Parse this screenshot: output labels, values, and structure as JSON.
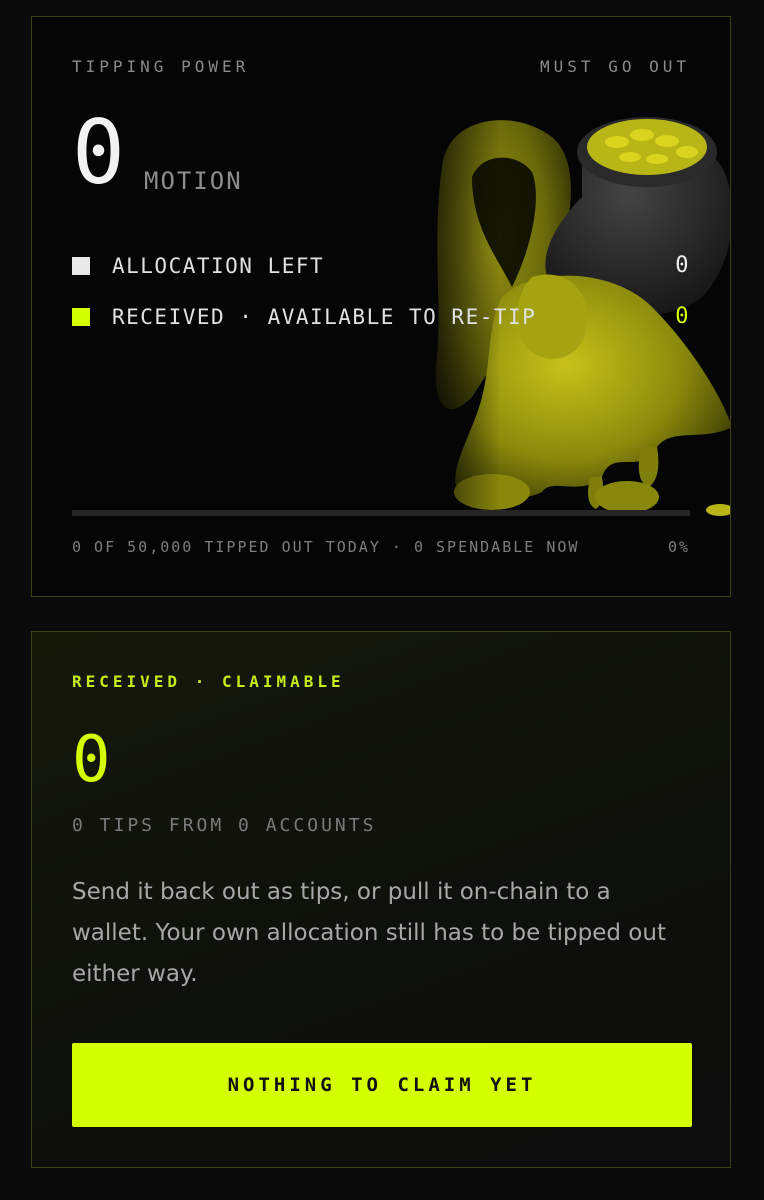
{
  "tipping_power": {
    "header_label": "TIPPING POWER",
    "header_right": "MUST GO OUT",
    "amount": "0",
    "unit": "MOTION",
    "legend": [
      {
        "label": "ALLOCATION LEFT",
        "value": "0",
        "color": "#e9e9e9"
      },
      {
        "label": "RECEIVED · AVAILABLE TO RE-TIP",
        "value": "0",
        "color": "#d4ff00"
      }
    ],
    "progress_fraction": 0,
    "footer_left": "0 OF 50,000 TIPPED OUT TODAY · 0 SPENDABLE NOW",
    "footer_right": "0%",
    "illustration": "yellow-hooded-figure-with-coin-sack"
  },
  "claimable": {
    "label": "RECEIVED · CLAIMABLE",
    "amount": "0",
    "subtitle": "0 TIPS FROM 0 ACCOUNTS",
    "description": "Send it back out as tips, or pull it on-chain to a wallet. Your own allocation still has to be tipped out either way.",
    "button_label": "NOTHING TO CLAIM YET"
  },
  "colors": {
    "accent": "#d4ff00",
    "border": "#3b4210",
    "background": "#0a0a0a"
  }
}
